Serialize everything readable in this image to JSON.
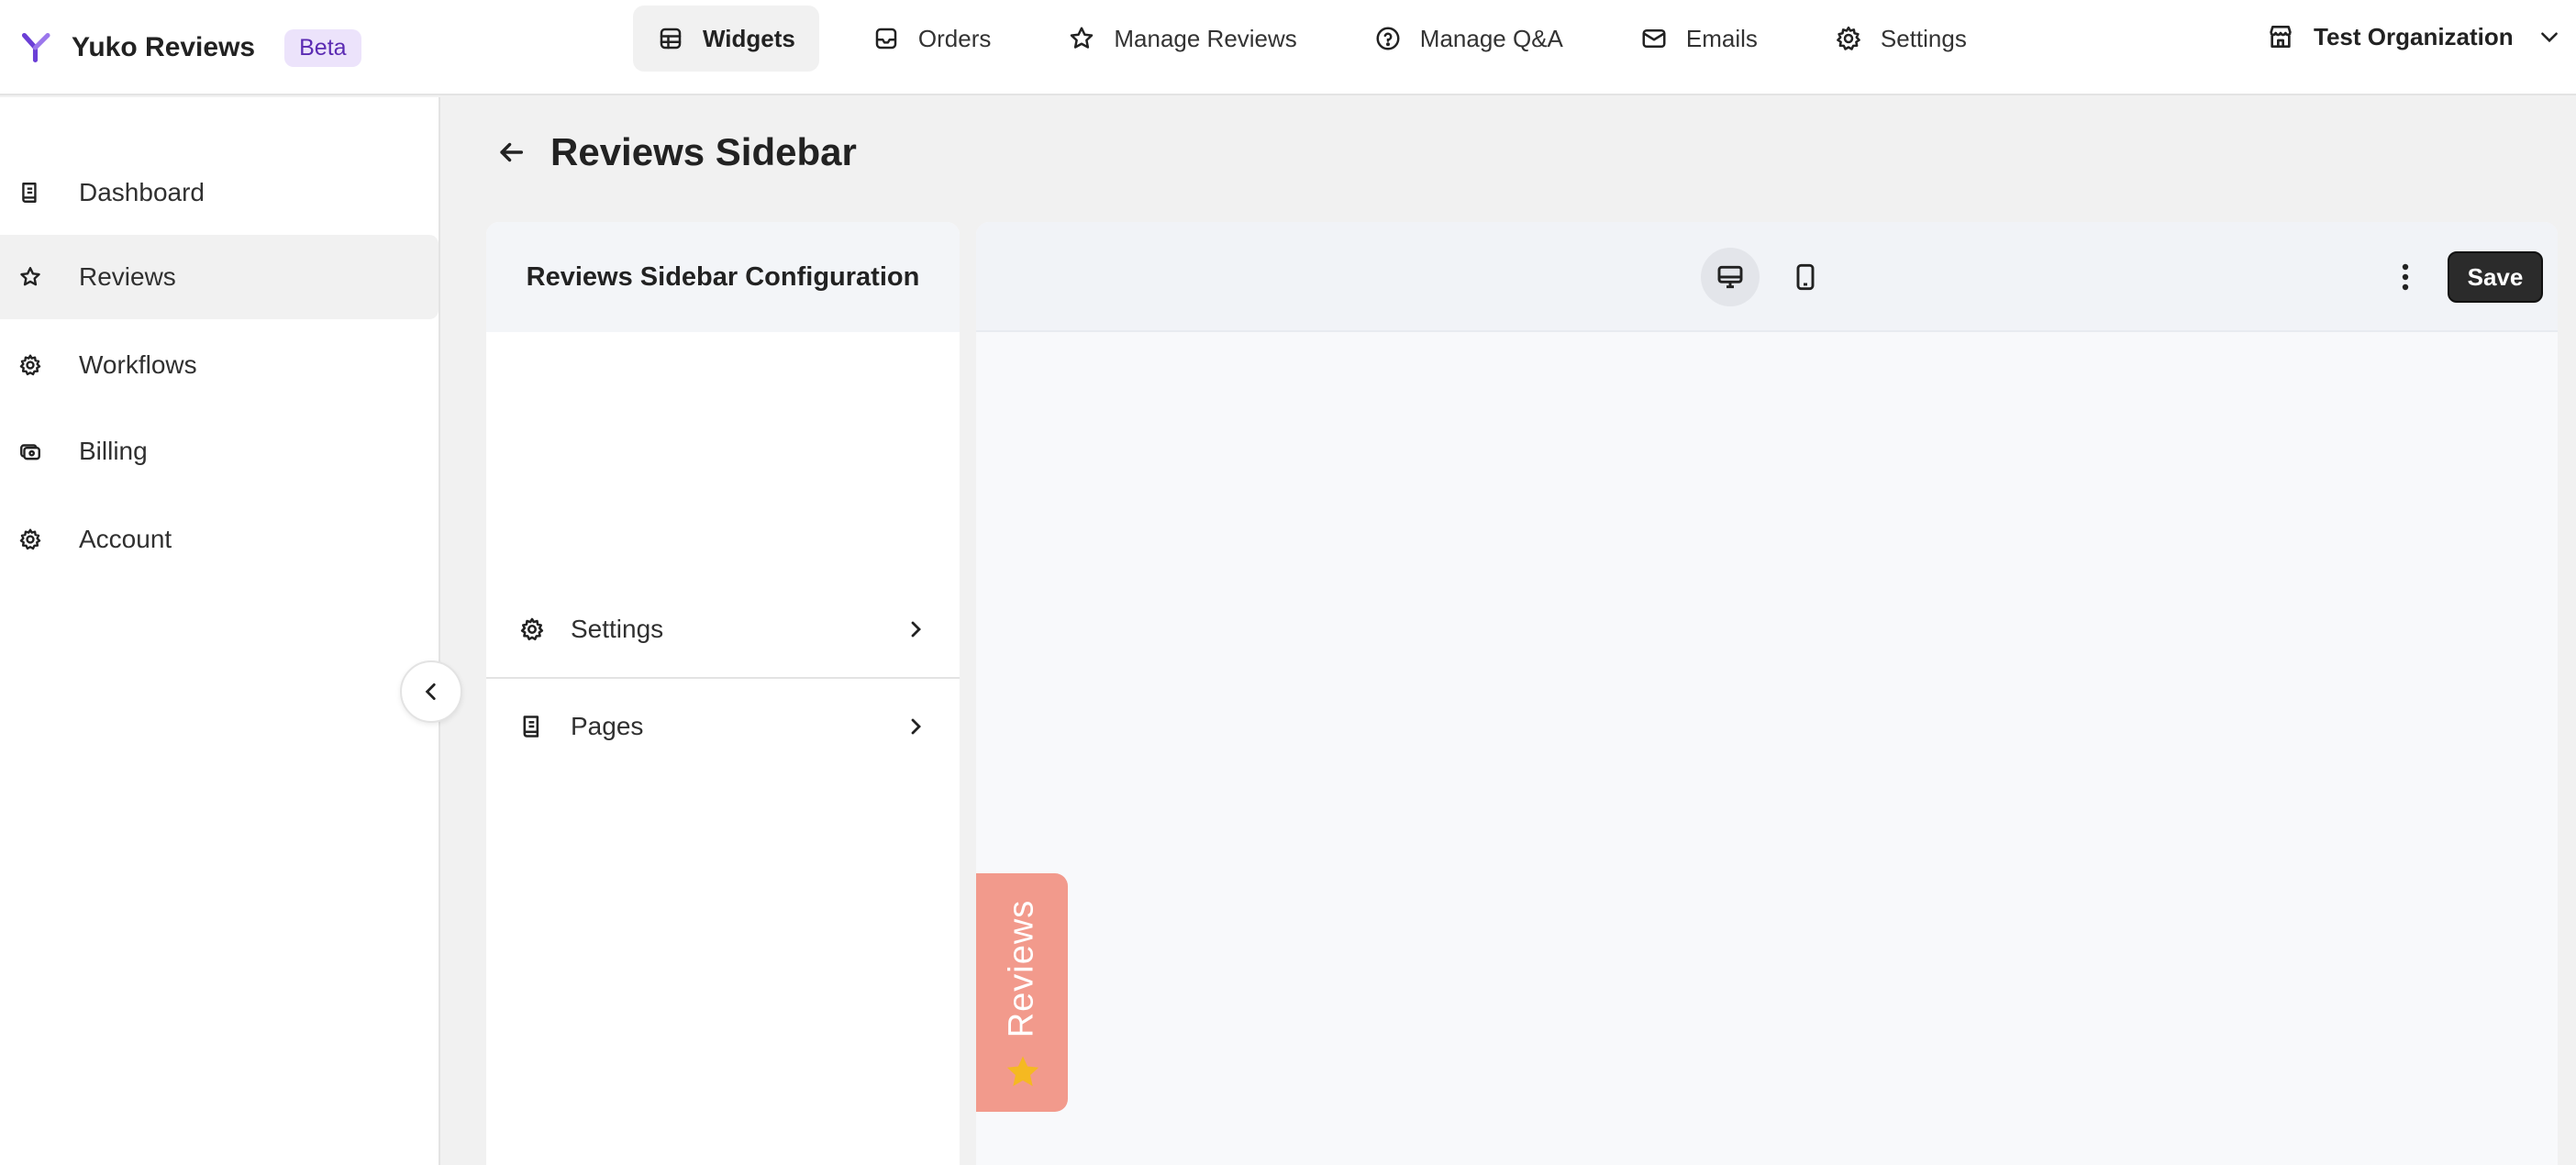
{
  "app": {
    "title": "Yuko Reviews",
    "badge": "Beta",
    "brand_color": "#6b3fd6"
  },
  "topnav": {
    "items": [
      {
        "label": "Widgets",
        "icon": "widgets-icon",
        "active": true
      },
      {
        "label": "Orders",
        "icon": "inbox-icon"
      },
      {
        "label": "Manage Reviews",
        "icon": "star-icon"
      },
      {
        "label": "Manage Q&A",
        "icon": "question-icon"
      },
      {
        "label": "Emails",
        "icon": "mail-icon"
      },
      {
        "label": "Settings",
        "icon": "gear-icon"
      }
    ]
  },
  "org": {
    "name": "Test Organization",
    "icon": "store-icon"
  },
  "sidebar": {
    "items": [
      {
        "label": "Dashboard",
        "icon": "book-icon"
      },
      {
        "label": "Reviews",
        "icon": "star-icon",
        "active": true
      },
      {
        "label": "Workflows",
        "icon": "gear-icon"
      },
      {
        "label": "Billing",
        "icon": "billing-icon"
      },
      {
        "label": "Account",
        "icon": "gear-icon"
      }
    ]
  },
  "page": {
    "title": "Reviews Sidebar"
  },
  "config": {
    "title": "Reviews Sidebar Configuration",
    "rows": [
      {
        "label": "Settings",
        "icon": "gear-icon"
      },
      {
        "label": "Pages",
        "icon": "book-icon"
      }
    ]
  },
  "preview": {
    "save_label": "Save",
    "active_device": "desktop",
    "tab_label": "Reviews",
    "tab_color": "#f29a8c",
    "star_color": "#f5b921"
  }
}
